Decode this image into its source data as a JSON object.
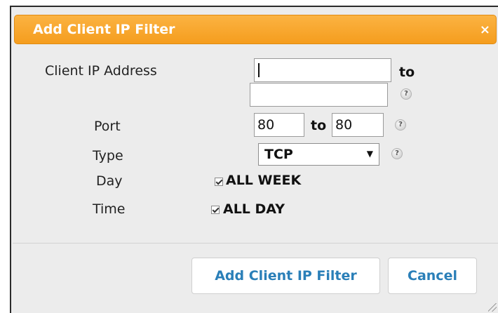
{
  "dialog": {
    "title": "Add Client IP Filter",
    "close_glyph": "×"
  },
  "form": {
    "client_ip_label": "Client IP Address",
    "ip_from_value": "",
    "ip_to_value": "",
    "to_text": "to",
    "port_label": "Port",
    "port_from_value": "80",
    "port_to_value": "80",
    "type_label": "Type",
    "type_selected": "TCP",
    "day_label": "Day",
    "day_checkbox_label": "ALL WEEK",
    "day_checked": true,
    "time_label": "Time",
    "time_checkbox_label": "ALL DAY",
    "time_checked": true,
    "help_glyph": "?"
  },
  "buttons": {
    "add_label": "Add Client IP Filter",
    "cancel_label": "Cancel"
  },
  "colors": {
    "titlebar": "#f7a52c",
    "button_text": "#2a7fb8",
    "dialog_bg": "#ececec"
  }
}
